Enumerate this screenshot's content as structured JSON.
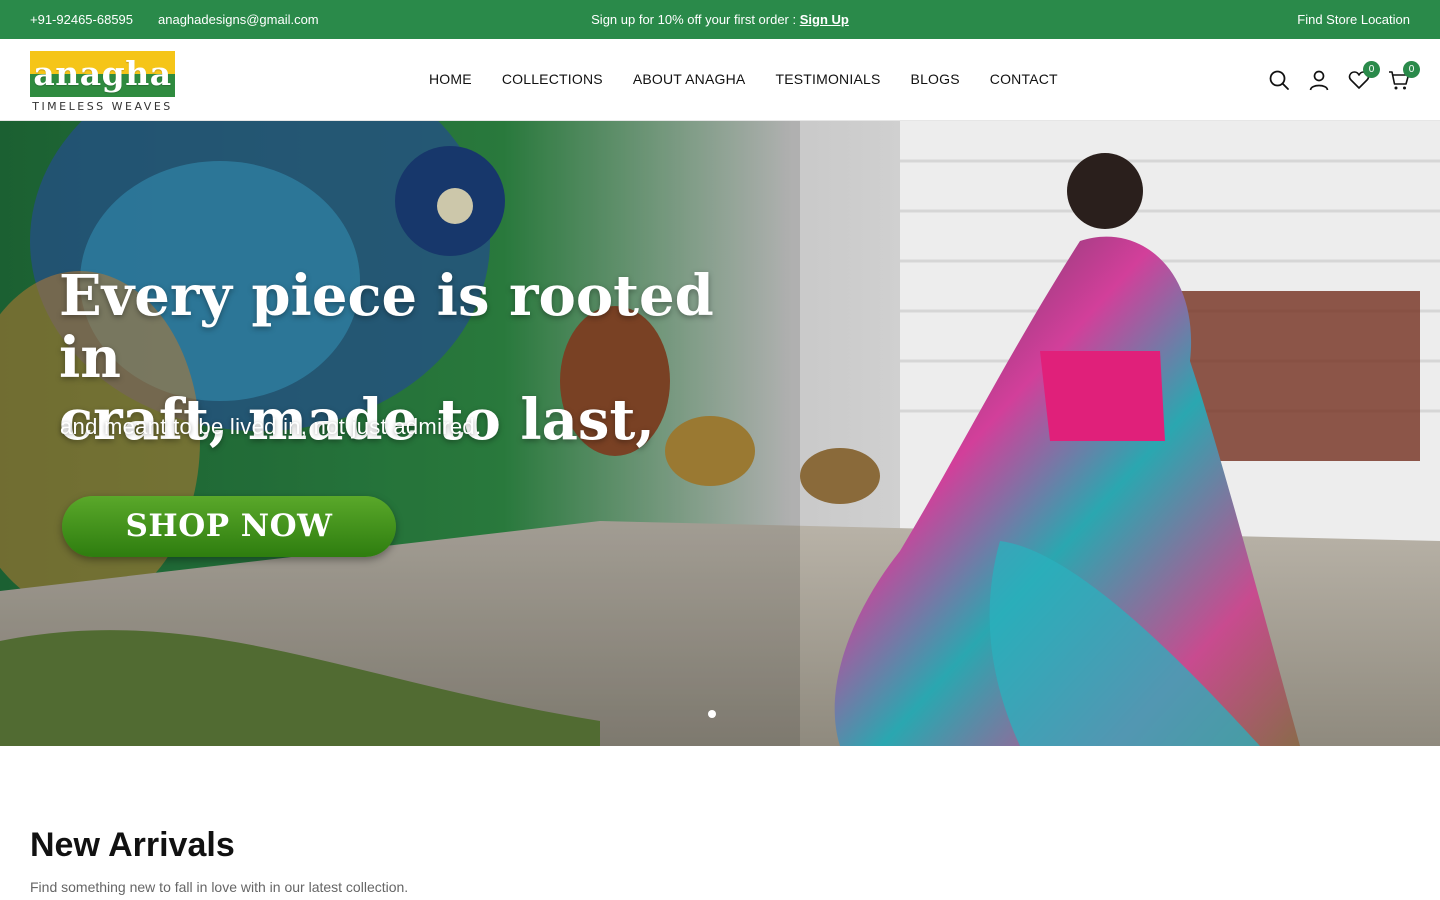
{
  "topbar": {
    "phone": "+91-92465-68595",
    "email": "anaghadesigns@gmail.com",
    "promo_text": "Sign up for 10% off your first order : ",
    "promo_link": "Sign Up",
    "store_link": "Find Store Location",
    "bg_color": "#2a8a4a"
  },
  "header": {
    "logo_word": "anagha",
    "logo_tagline": "TIMELESS WEAVES",
    "nav": [
      "HOME",
      "COLLECTIONS",
      "ABOUT ANAGHA",
      "TESTIMONIALS",
      "BLOGS",
      "CONTACT"
    ],
    "icons": [
      "search-icon",
      "account-icon",
      "wishlist-icon",
      "cart-icon"
    ],
    "wishlist_count": "0",
    "cart_count": "0"
  },
  "hero": {
    "headline_line1": "Every piece is rooted in",
    "headline_line2": "craft, made to last,",
    "subheadline": "and meant to be lived in,  not just admired.",
    "cta": "SHOP NOW",
    "slide_index": 1
  },
  "new_arrivals": {
    "title": "New Arrivals",
    "subtitle": "Find something new to fall in love with in our latest collection."
  }
}
